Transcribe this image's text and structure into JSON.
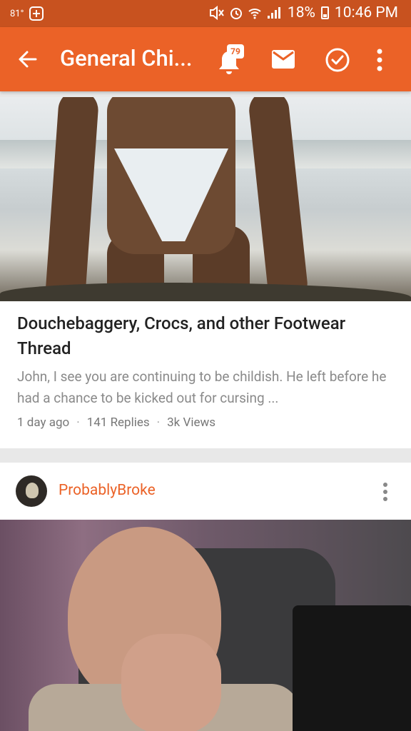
{
  "status_bar": {
    "temperature": "81°",
    "battery": "18%",
    "time": "10:46 PM"
  },
  "app_bar": {
    "title": "General Chi...",
    "notification_count": "79",
    "icons": [
      "back-arrow-icon",
      "bell-icon",
      "mail-icon",
      "check-circle-icon",
      "more-vert-icon"
    ]
  },
  "post1": {
    "title": "Douchebaggery, Crocs, and other Footwear Thread",
    "excerpt": "John, I see you are continuing to be childish. He left before he had a chance to be kicked out for cursing ...",
    "time": "1 day ago",
    "replies": "141 Replies",
    "views": "3k Views",
    "separator": "·"
  },
  "post2": {
    "author": "ProbablyBroke"
  },
  "colors": {
    "status_bar": "#c8521f",
    "app_bar": "#eb6227",
    "author": "#eb6227"
  }
}
